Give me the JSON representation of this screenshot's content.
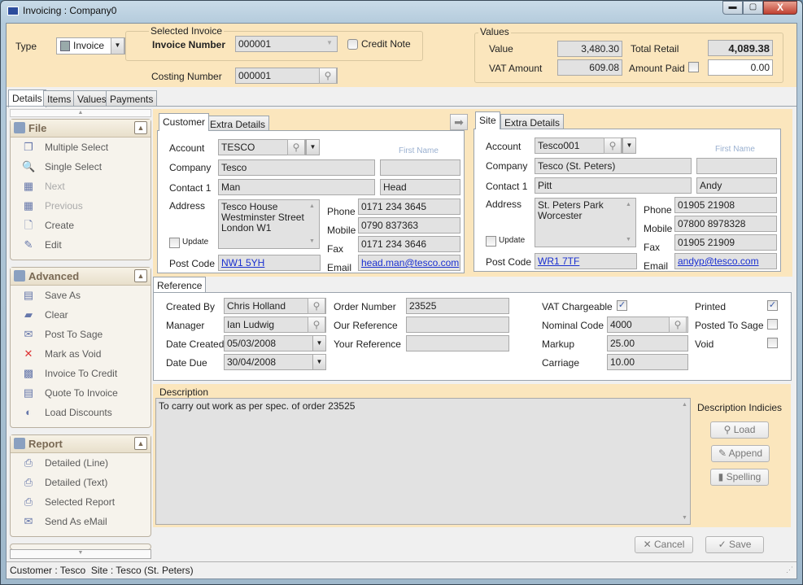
{
  "window": {
    "title": "Invoicing : Company0"
  },
  "header": {
    "type_label": "Type",
    "type_value": "Invoice",
    "selected_invoice_legend": "Selected Invoice",
    "invoice_number_label": "Invoice Number",
    "invoice_number": "000001",
    "credit_note_label": "Credit Note",
    "credit_note_checked": false,
    "costing_number_label": "Costing Number",
    "costing_number": "000001",
    "values_legend": "Values",
    "value_label": "Value",
    "value": "3,480.30",
    "vat_label": "VAT Amount",
    "vat": "609.08",
    "total_retail_label": "Total Retail",
    "total_retail": "4,089.38",
    "amount_paid_label": "Amount Paid",
    "amount_paid": "0.00",
    "amount_paid_checked": false
  },
  "tabs": [
    "Details",
    "Items",
    "Values",
    "Payments"
  ],
  "sidebar": {
    "file": {
      "title": "File",
      "items": [
        {
          "label": "Multiple Select",
          "icon": "multiple-select-icon",
          "g": "❐",
          "disabled": false
        },
        {
          "label": "Single Select",
          "icon": "magnifier-icon",
          "g": "🔍",
          "disabled": false
        },
        {
          "label": "Next",
          "icon": "next-icon",
          "g": "▦",
          "disabled": true
        },
        {
          "label": "Previous",
          "icon": "previous-icon",
          "g": "▦",
          "disabled": true
        },
        {
          "label": "Create",
          "icon": "document-icon",
          "g": "🗋",
          "disabled": false
        },
        {
          "label": "Edit",
          "icon": "edit-icon",
          "g": "✎",
          "disabled": false
        }
      ]
    },
    "advanced": {
      "title": "Advanced",
      "items": [
        {
          "label": "Save As",
          "icon": "save-as-icon",
          "g": "▤",
          "disabled": false
        },
        {
          "label": "Clear",
          "icon": "eraser-icon",
          "g": "▰",
          "disabled": false
        },
        {
          "label": "Post To Sage",
          "icon": "envelope-icon",
          "g": "✉",
          "disabled": false
        },
        {
          "label": "Mark as Void",
          "icon": "cross-icon",
          "g": "✕",
          "disabled": false
        },
        {
          "label": "Invoice To Credit",
          "icon": "invoice-credit-icon",
          "g": "▩",
          "disabled": false
        },
        {
          "label": "Quote To Invoice",
          "icon": "quote-invoice-icon",
          "g": "▤",
          "disabled": false
        },
        {
          "label": "Load Discounts",
          "icon": "discount-icon",
          "g": "◐",
          "disabled": false
        }
      ]
    },
    "report": {
      "title": "Report",
      "items": [
        {
          "label": "Detailed (Line)",
          "icon": "printer-icon",
          "g": "⎙",
          "disabled": false
        },
        {
          "label": "Detailed (Text)",
          "icon": "printer-icon",
          "g": "⎙",
          "disabled": false
        },
        {
          "label": "Selected Report",
          "icon": "printer-icon",
          "g": "⎙",
          "disabled": false
        },
        {
          "label": "Send As eMail",
          "icon": "send-email-icon",
          "g": "✉",
          "disabled": false
        }
      ]
    }
  },
  "customer": {
    "tabs": [
      "Customer",
      "Extra Details"
    ],
    "labels": {
      "account": "Account",
      "company": "Company",
      "contact": "Contact 1",
      "address": "Address",
      "update": "Update",
      "postcode": "Post Code",
      "phone": "Phone",
      "mobile": "Mobile",
      "fax": "Fax",
      "email": "Email",
      "first_name": "First Name"
    },
    "account": "TESCO",
    "company": "Tesco",
    "company2": "",
    "contact_last": "Man",
    "contact_first": "Head",
    "address": [
      "Tesco House",
      "Westminster Street",
      "London W1"
    ],
    "postcode": "NW1 5YH",
    "phone": "0171 234 3645",
    "mobile": "0790 837363",
    "fax": "0171 234 3646",
    "email": "head.man@tesco.com"
  },
  "site": {
    "tabs": [
      "Site",
      "Extra Details"
    ],
    "labels": {
      "account": "Account",
      "company": "Company",
      "contact": "Contact 1",
      "address": "Address",
      "update": "Update",
      "postcode": "Post Code",
      "phone": "Phone",
      "mobile": "Mobile",
      "fax": "Fax",
      "email": "Email",
      "first_name": "First Name"
    },
    "account": "Tesco001",
    "company": "Tesco (St. Peters)",
    "company2": "",
    "contact_last": "Pitt",
    "contact_first": "Andy",
    "address": [
      "St. Peters Park",
      "Worcester"
    ],
    "postcode": "WR1 7TF",
    "phone": "01905 21908",
    "mobile": "07800 8978328",
    "fax": "01905 21909",
    "email": "andyp@tesco.com"
  },
  "reference": {
    "tab": "Reference",
    "created_by_label": "Created By",
    "created_by": "Chris Holland",
    "manager_label": "Manager",
    "manager": "Ian Ludwig",
    "date_created_label": "Date Created",
    "date_created": "05/03/2008",
    "date_due_label": "Date Due",
    "date_due": "30/04/2008",
    "order_number_label": "Order Number",
    "order_number": "23525",
    "our_ref_label": "Our Reference",
    "our_ref": "",
    "your_ref_label": "Your Reference",
    "your_ref": "",
    "vat_chargeable_label": "VAT Chargeable",
    "vat_chargeable": true,
    "nominal_code_label": "Nominal Code",
    "nominal_code": "4000",
    "markup_label": "Markup",
    "markup": "25.00",
    "carriage_label": "Carriage",
    "carriage": "10.00",
    "printed_label": "Printed",
    "printed": true,
    "posted_label": "Posted To Sage",
    "posted": false,
    "void_label": "Void",
    "void": false
  },
  "description": {
    "label": "Description",
    "text": "To carry out work as per spec. of order 23525",
    "indicies_label": "Description Indicies",
    "load": "Load",
    "append": "Append",
    "spelling": "Spelling"
  },
  "actions": {
    "cancel": "Cancel",
    "save": "Save"
  },
  "status": {
    "text": "Customer : Tesco  Site : Tesco (St. Peters)"
  }
}
